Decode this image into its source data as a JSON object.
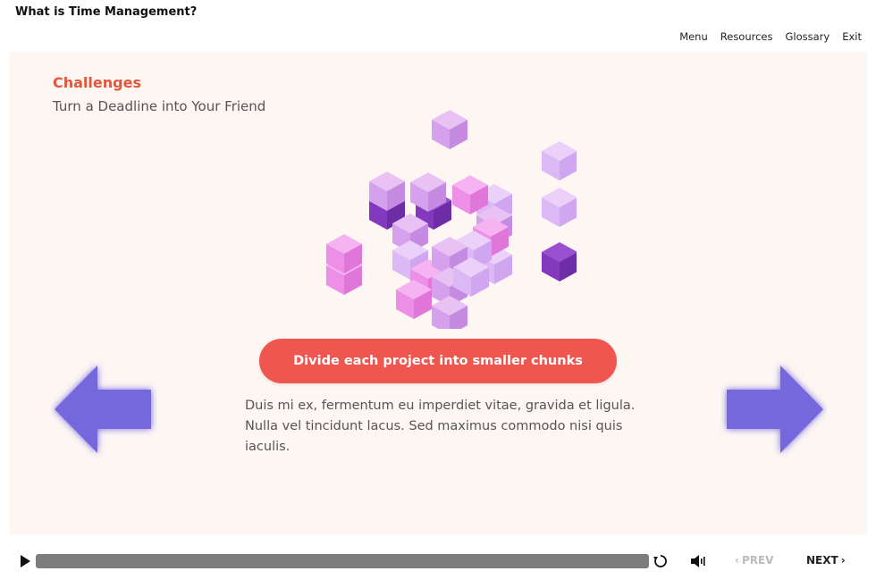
{
  "app": {
    "title": "What is Time Management?"
  },
  "menu": {
    "items": [
      {
        "label": "Menu",
        "name": "menu-link-menu"
      },
      {
        "label": "Resources",
        "name": "menu-link-resources"
      },
      {
        "label": "Glossary",
        "name": "menu-link-glossary"
      },
      {
        "label": "Exit",
        "name": "menu-link-exit"
      }
    ]
  },
  "slide": {
    "heading": "Challenges",
    "subheading": "Turn a Deadline into Your Friend",
    "tip_label": "Divide each project into smaller chunks",
    "body": "Duis mi ex, fermentum eu imperdiet vitae, gravida et ligula. Nulla vel tincidunt lacus. Sed maximus commodo nisi quis iaculis.",
    "illustration_icon": "cubes-illustration",
    "left_arrow_icon": "arrow-left-icon",
    "right_arrow_icon": "arrow-right-icon"
  },
  "player": {
    "play_icon": "play-icon",
    "replay_icon": "replay-icon",
    "volume_icon": "volume-icon",
    "prev_label": "PREV",
    "next_label": "NEXT"
  },
  "colors": {
    "accent": "#e2573c",
    "pill": "#ef5650",
    "arrow": "#7468dd",
    "slide_bg": "#fdf6f3",
    "seek_track": "#7d7d7d"
  }
}
